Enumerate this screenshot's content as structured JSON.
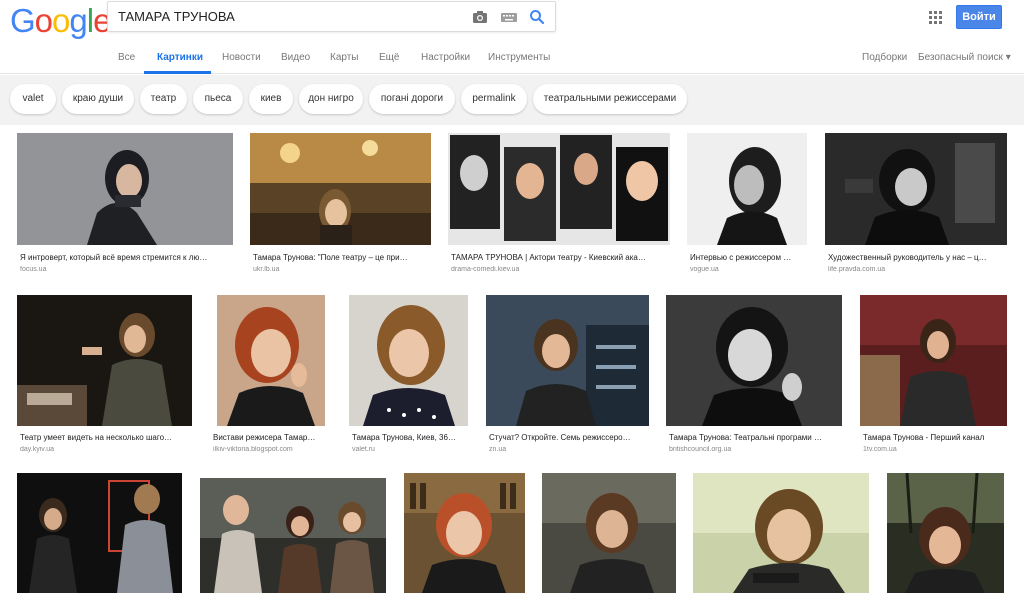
{
  "header": {
    "logo_letters": [
      "G",
      "o",
      "o",
      "g",
      "l",
      "e"
    ],
    "logo_colors": [
      "#4285F4",
      "#EA4335",
      "#FBBC05",
      "#4285F4",
      "#34A853",
      "#EA4335"
    ],
    "search_value": "ТАМАРА ТРУНОВА",
    "signin_label": "Войти",
    "accent": "#1a73e8"
  },
  "tabs": {
    "items": [
      "Все",
      "Картинки",
      "Новости",
      "Видео",
      "Карты",
      "Ещё",
      "Настройки",
      "Инструменты"
    ],
    "active": "Картинки",
    "right": [
      "Подборки",
      "Безопасный поиск ▾"
    ]
  },
  "chips": [
    "valet",
    "краю души",
    "театр",
    "пьеса",
    "киев",
    "дон нигро",
    "погані дороги",
    "permalink",
    "театральными режиссерами"
  ],
  "results": [
    {
      "caption": "Я интроверт, который всё время стремится к лю…",
      "source": "focus.ua"
    },
    {
      "caption": "Тамара Трунова: \"Поле театру – це при…",
      "source": "ukr.lb.ua"
    },
    {
      "caption": "ТАМАРА ТРУНОВА | Актори театру - Киевский ака…",
      "source": "drama-comedi.kiev.ua"
    },
    {
      "caption": "Интервью с режиссером …",
      "source": "vogue.ua"
    },
    {
      "caption": "Художественный руководитель у нас – ц…",
      "source": "life.pravda.com.ua"
    },
    {
      "caption": "Театр умеет видеть на несколько шаго…",
      "source": "day.kyiv.ua"
    },
    {
      "caption": "Вистави режисера Тамар…",
      "source": "ilkiv-viktoria.blogspot.com"
    },
    {
      "caption": "Тамара Трунова, Киев, 36…",
      "source": "valet.ru"
    },
    {
      "caption": "Стучат? Откройте. Семь режиссеро…",
      "source": "zn.ua"
    },
    {
      "caption": "Тамара Трунова: Театральні програми …",
      "source": "britishcouncil.org.ua"
    },
    {
      "caption": "Тамара Трунова - Перший канал",
      "source": "1tv.com.ua"
    },
    {
      "caption": "",
      "source": ""
    },
    {
      "caption": "",
      "source": ""
    },
    {
      "caption": "",
      "source": ""
    },
    {
      "caption": "",
      "source": ""
    },
    {
      "caption": "",
      "source": ""
    },
    {
      "caption": "",
      "source": ""
    }
  ],
  "icons": [
    "camera-icon",
    "keyboard-icon",
    "search-icon",
    "apps-grid-icon"
  ]
}
